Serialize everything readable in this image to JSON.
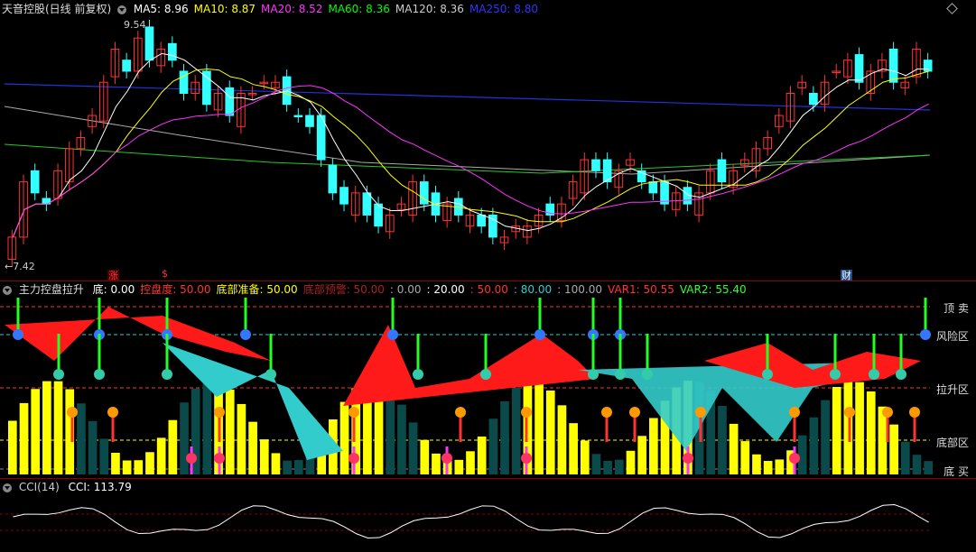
{
  "main": {
    "title": "天音控股(日线 前复权)",
    "ma": [
      {
        "label": "MA5: 8.96",
        "color": "#ffffff"
      },
      {
        "label": "MA10: 8.87",
        "color": "#ffff00"
      },
      {
        "label": "MA20: 8.52",
        "color": "#ff33ff"
      },
      {
        "label": "MA60: 8.36",
        "color": "#00ff00"
      },
      {
        "label": "MA120: 8.36",
        "color": "#cccccc"
      },
      {
        "label": "MA250: 8.80",
        "color": "#3333ff"
      }
    ],
    "high_label": "9.54",
    "low_label": "7.42",
    "markers": [
      {
        "text": "涨",
        "color": "#ff3333"
      },
      {
        "text": "$",
        "color": "#ff3333"
      },
      {
        "text": "财",
        "color": "#66aaff"
      }
    ]
  },
  "indicator": {
    "title": "主力控盘拉升",
    "fields": [
      {
        "label": "底: 0.00",
        "color": "#ffffff"
      },
      {
        "label": "控盘度: 50.00",
        "color": "#ff3333"
      },
      {
        "label": "底部准备: 50.00",
        "color": "#ffff00"
      },
      {
        "label": "底部预警: 50.00",
        "color": "#aa2222"
      },
      {
        "label": ": 0.00",
        "color": "#aaaaaa"
      },
      {
        "label": ": 20.00",
        "color": "#ffffff"
      },
      {
        "label": ": 50.00",
        "color": "#ff3333"
      },
      {
        "label": ": 80.00",
        "color": "#33cccc"
      },
      {
        "label": ": 100.00",
        "color": "#aaaaaa"
      },
      {
        "label": "VAR1: 50.55",
        "color": "#ff3333"
      },
      {
        "label": "VAR2: 55.40",
        "color": "#33ff33"
      }
    ],
    "zones": [
      "顶 卖",
      "风险区",
      "拉升区",
      "底部区",
      "底 买"
    ]
  },
  "cci": {
    "title": "CCI(14)",
    "value": "CCI: 113.79"
  }
}
